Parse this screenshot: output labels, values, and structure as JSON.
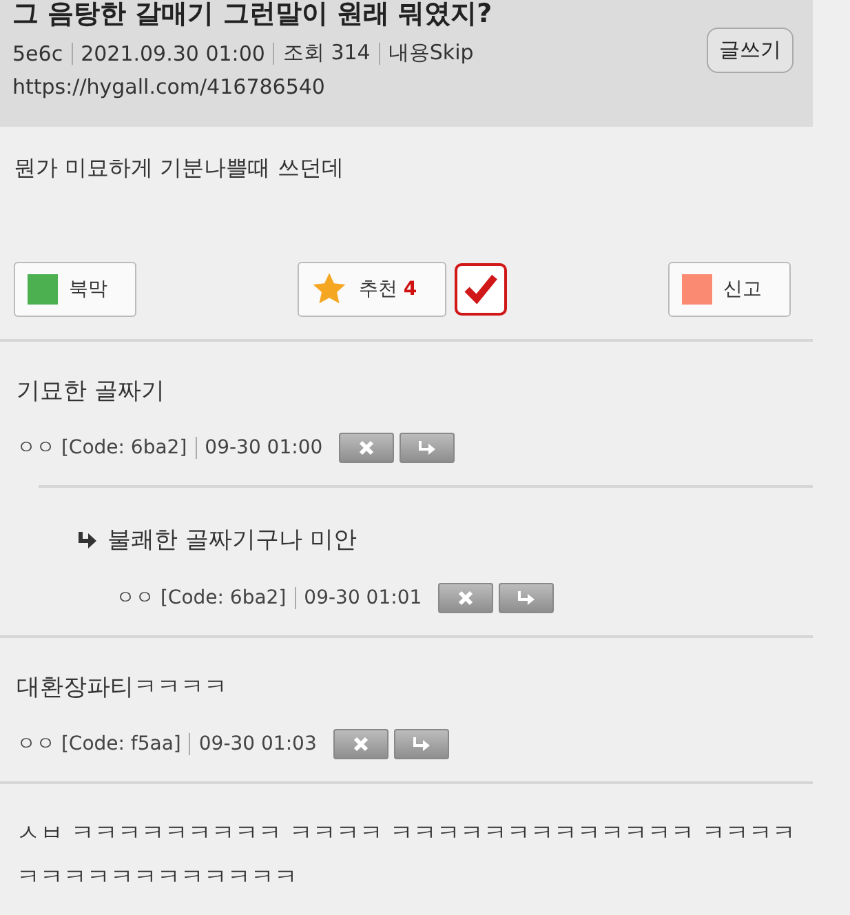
{
  "post": {
    "title": "그 음탕한 갈매기 그런말이 원래 뭐였지?",
    "meta": [
      "5e6c",
      "2021.09.30 01:00",
      "조회 314",
      "내용Skip"
    ],
    "url": "https://hygall.com/416786540",
    "write_button": "글쓰기",
    "body": "뭔가 미묘하게 기분나쁠때 쓰던데"
  },
  "actions": {
    "bookmark": "북막",
    "recommend": {
      "label": "추천",
      "count": "4",
      "checked": true
    },
    "report": "신고"
  },
  "comments": [
    {
      "text": "기묘한 골짜기",
      "nick": "ㅇㅇ",
      "code": "[Code: 6ba2]",
      "time": "09-30 01:00",
      "children": [
        {
          "text": "불쾌한 골짜기구나 미안",
          "nick": "ㅇㅇ",
          "code": "[Code: 6ba2]",
          "time": "09-30 01:01"
        }
      ]
    },
    {
      "text": "대환장파티ㅋㅋㅋㅋ",
      "nick": "ㅇㅇ",
      "code": "[Code: f5aa]",
      "time": "09-30 01:03"
    },
    {
      "text": "ㅅㅂ ㅋㅋㅋㅋㅋㅋㅋㅋㅋ ㅋㅋㅋㅋ ㅋㅋㅋㅋㅋㅋㅋㅋㅋㅋㅋㅋㅋ ㅋㅋㅋㅋㅋㅋㅋㅋㅋㅋㅋㅋㅋㅋㅋㅋ"
    }
  ]
}
